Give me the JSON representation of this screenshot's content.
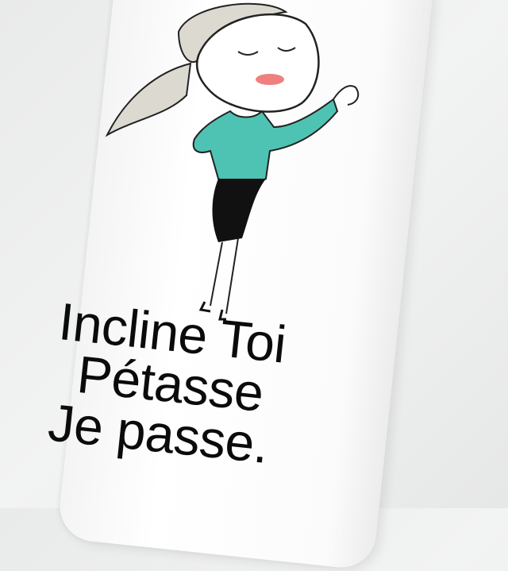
{
  "phone_case": {
    "slogan": {
      "line1": "Incline Toi",
      "line2": "Pétasse",
      "line3": "Je passe."
    },
    "illustration": {
      "subject": "woman-illustration",
      "colors": {
        "sweater": "#4fc3b3",
        "skirt": "#111111",
        "lips": "#f08080",
        "hair": "#d9d6cf",
        "case": "#ffffff"
      }
    }
  }
}
